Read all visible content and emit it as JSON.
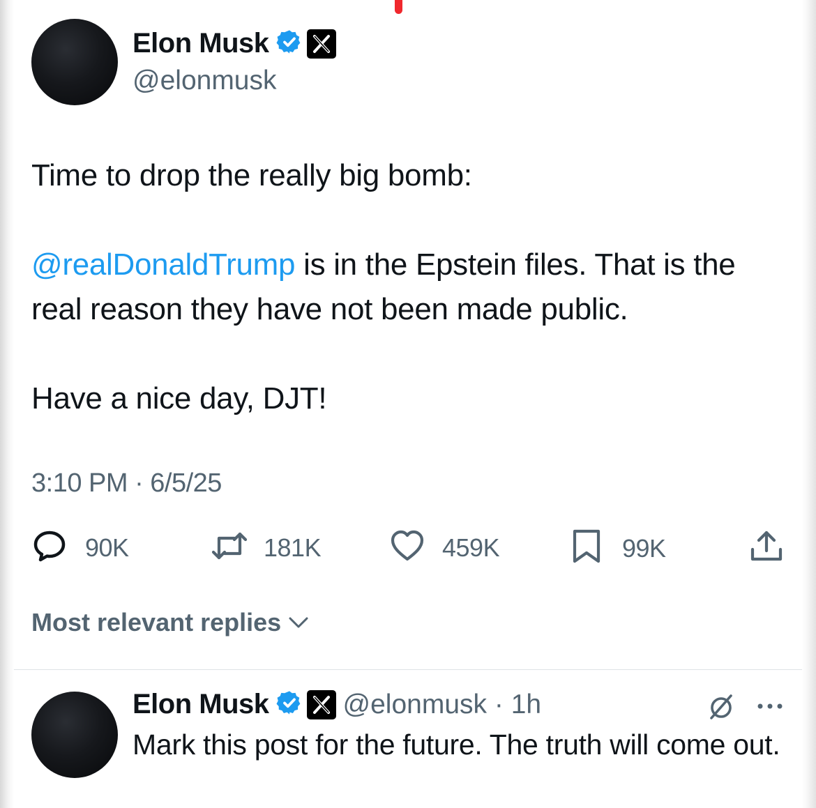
{
  "tweet": {
    "author_name": "Elon Musk",
    "author_handle": "@elonmusk",
    "text_line_1": "Time to drop the really big bomb:",
    "mention": "@realDonaldTrump",
    "text_line_2": " is in the Epstein files. That is the real reason they have not been made public.",
    "text_line_3": "Have a nice day, DJT!",
    "timestamp": "3:10 PM · 6/5/25",
    "actions": {
      "replies": "90K",
      "reposts": "181K",
      "likes": "459K",
      "bookmarks": "99K"
    },
    "icons": {
      "verified": "verified-badge-icon",
      "affiliation": "x-logo-icon",
      "reply": "comment-icon",
      "repost": "repost-icon",
      "like": "heart-icon",
      "bookmark": "bookmark-icon",
      "share": "share-icon"
    }
  },
  "replies_sort": {
    "label": "Most relevant replies"
  },
  "reply": {
    "author_name": "Elon Musk",
    "author_handle_time": "@elonmusk · 1h",
    "text": "Mark this post for the future. The truth will come out.",
    "icons": {
      "grok": "grok-icon",
      "more": "more-options-icon"
    }
  },
  "colors": {
    "link": "#1d9bf0",
    "verified": "#1d9bf0",
    "secondary_text": "#536471",
    "primary_text": "#0f1419",
    "accent_mark": "#f0282d"
  }
}
